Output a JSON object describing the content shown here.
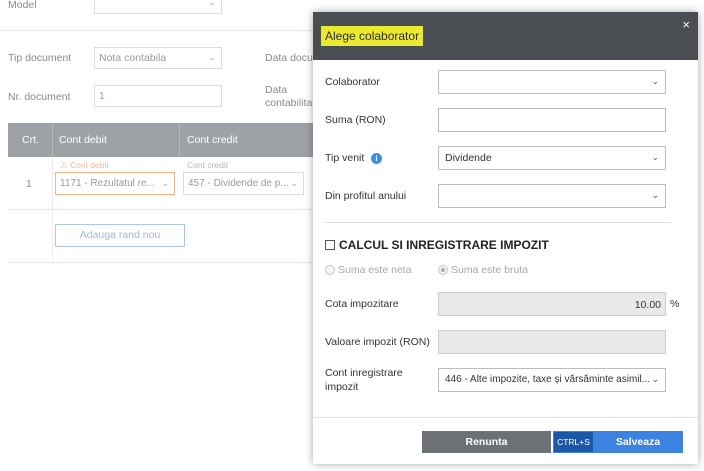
{
  "background": {
    "model_label": "Model",
    "tip_document_label": "Tip document",
    "tip_document_value": "Nota contabila",
    "data_document_label": "Data docum",
    "nr_document_label": "Nr. document",
    "nr_document_value": "1",
    "data_contabilitate_label_1": "Data",
    "data_contabilitate_label_2": "contabilitat",
    "table": {
      "headers": [
        "Crt.",
        "Cont debit",
        "Cont credit"
      ],
      "row": {
        "number": "1",
        "debit_label": "⚠ Cont debit",
        "debit_value": "1171 - Rezultatul re...",
        "credit_label": "Cont credit",
        "credit_value": "457 - Dividende de p..."
      }
    },
    "add_row_label": "Adauga rand nou"
  },
  "modal": {
    "title": "Alege colaborator",
    "close_icon": "×",
    "fields": {
      "colaborator_label": "Colaborator",
      "colaborator_value": "",
      "suma_label": "Suma (RON)",
      "suma_value": "",
      "tip_venit_label": "Tip venit",
      "tip_venit_value": "Dividende",
      "din_profitul_label": "Din profitul anului",
      "din_profitul_value": ""
    },
    "calcul_label": "CALCUL SI INREGISTRARE IMPOZIT",
    "radio_neta": "Suma este neta",
    "radio_bruta": "Suma este bruta",
    "cota_label": "Cota impozitare",
    "cota_value": "10.00",
    "cota_unit": "%",
    "valoare_label": "Valoare impozit (RON)",
    "cont_label_1": "Cont inregistrare",
    "cont_label_2": "impozit",
    "cont_value": "446 - Alte impozite, taxe și vărsăminte asimil...",
    "cancel_label": "Renunta",
    "save_shortcut": "CTRL+S",
    "save_label": "Salveaza"
  },
  "colors": {
    "header_bg": "#4a4d52",
    "highlight": "#eaea2e",
    "primary": "#3c82e0",
    "secondary": "#6d7176",
    "info": "#3a8fd9"
  }
}
